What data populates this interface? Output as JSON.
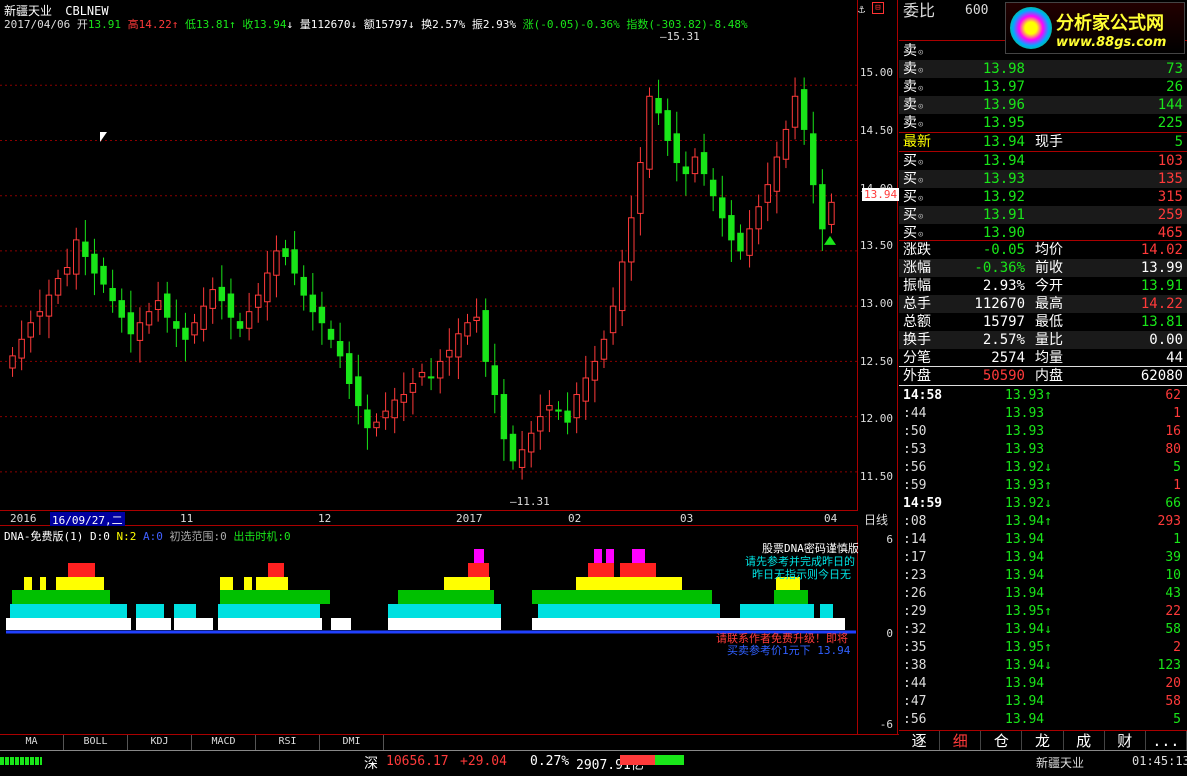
{
  "header": {
    "stock_name": "新疆天业",
    "formula": "CBLNEW",
    "date": "2017/04/06",
    "open_label": "开",
    "open_value": "13.91",
    "high_label": "高",
    "high_value": "14.22",
    "low_label": "低",
    "low_value": "13.81",
    "close_label": "收",
    "close_value": "13.94",
    "vol_label": "量",
    "vol_value": "112670",
    "amt_label": "额",
    "amt_value": "15797",
    "turn_label": "换",
    "turn_value": "2.57%",
    "amp_label": "振",
    "amp_value": "2.93%",
    "chg_text": "涨(-0.05)-0.36%",
    "index_text": "指数(-303.82)-8.48%"
  },
  "price_axis": {
    "ticks": [
      "15.00",
      "14.50",
      "14.00",
      "13.50",
      "13.00",
      "12.50",
      "12.00",
      "11.50"
    ],
    "current": "13.94"
  },
  "annotations": {
    "high_mark": "15.31",
    "low_mark": "11.31"
  },
  "x_axis": {
    "labels": [
      "2016",
      "16/09/27,二",
      "11",
      "12",
      "2017",
      "02",
      "03",
      "04"
    ],
    "right_label": "日线"
  },
  "indicator": {
    "name": "DNA-免费版(1)",
    "d_label": "D:0",
    "n_label": "N:2",
    "a_label": "A:0",
    "range_label": "初选范围:0",
    "timing_label": "出击时机:0",
    "axis_ticks": [
      "6",
      "0",
      "-6"
    ],
    "note1": "股票DNA密码谨慎版",
    "note2": "请先参考并完成昨日的",
    "note3": "昨日无指示则今日无",
    "note4": "请联系作者免费升级！即将",
    "note5": "买卖参考价1元下 13.94"
  },
  "bottom_tabs": [
    "MA",
    "BOLL",
    "KDJ",
    "MACD",
    "RSI",
    "DMI"
  ],
  "status_bar": {
    "market": "深",
    "index_value": "10656.17",
    "index_change": "+29.04",
    "index_pct": "0.27%",
    "turnover": "2907.91亿",
    "stock": "新疆天业",
    "time": "01:45:13"
  },
  "logo": {
    "title": "分析家公式网",
    "url": "www.88gs.com"
  },
  "quote": {
    "code": "600",
    "ratio_label": "委比",
    "sells": [
      {
        "label": "卖",
        "price": "",
        "vol": ""
      },
      {
        "label": "卖",
        "price": "13.98",
        "vol": "73"
      },
      {
        "label": "卖",
        "price": "13.97",
        "vol": "26"
      },
      {
        "label": "卖",
        "price": "13.96",
        "vol": "144"
      },
      {
        "label": "卖",
        "price": "13.95",
        "vol": "225"
      }
    ],
    "last_label": "最新",
    "last_price": "13.94",
    "cur_label": "现手",
    "cur_vol": "5",
    "buys": [
      {
        "label": "买",
        "price": "13.94",
        "vol": "103"
      },
      {
        "label": "买",
        "price": "13.93",
        "vol": "135"
      },
      {
        "label": "买",
        "price": "13.92",
        "vol": "315"
      },
      {
        "label": "买",
        "price": "13.91",
        "vol": "259"
      },
      {
        "label": "买",
        "price": "13.90",
        "vol": "465"
      }
    ],
    "stats": [
      {
        "l1": "涨跌",
        "v1": "-0.05",
        "c1": "down",
        "l2": "均价",
        "v2": "14.02",
        "c2": "up"
      },
      {
        "l1": "涨幅",
        "v1": "-0.36%",
        "c1": "down",
        "l2": "前收",
        "v2": "13.99",
        "c2": "white"
      },
      {
        "l1": "振幅",
        "v1": "2.93%",
        "c1": "white",
        "l2": "今开",
        "v2": "13.91",
        "c2": "down"
      },
      {
        "l1": "总手",
        "v1": "112670",
        "c1": "white",
        "l2": "最高",
        "v2": "14.22",
        "c2": "up"
      },
      {
        "l1": "总额",
        "v1": "15797",
        "c1": "white",
        "l2": "最低",
        "v2": "13.81",
        "c2": "down"
      },
      {
        "l1": "换手",
        "v1": "2.57%",
        "c1": "white",
        "l2": "量比",
        "v2": "0.00",
        "c2": "white"
      },
      {
        "l1": "分笔",
        "v1": "2574",
        "c1": "white",
        "l2": "均量",
        "v2": "44",
        "c2": "white"
      }
    ],
    "outer_label": "外盘",
    "outer_value": "50590",
    "inner_label": "内盘",
    "inner_value": "62080"
  },
  "ticks": [
    {
      "t": "14:58",
      "p": "13.93↑",
      "q": "62",
      "qc": "up",
      "bold": true
    },
    {
      "t": ":44",
      "p": "13.93",
      "q": "1",
      "qc": "up"
    },
    {
      "t": ":50",
      "p": "13.93",
      "q": "16",
      "qc": "up"
    },
    {
      "t": ":53",
      "p": "13.93",
      "q": "80",
      "qc": "up"
    },
    {
      "t": ":56",
      "p": "13.92↓",
      "q": "5",
      "qc": "down"
    },
    {
      "t": ":59",
      "p": "13.93↑",
      "q": "1",
      "qc": "up"
    },
    {
      "t": "14:59",
      "p": "13.92↓",
      "q": "66",
      "qc": "down",
      "bold": true
    },
    {
      "t": ":08",
      "p": "13.94↑",
      "q": "293",
      "qc": "up"
    },
    {
      "t": ":14",
      "p": "13.94",
      "q": "1",
      "qc": "down"
    },
    {
      "t": ":17",
      "p": "13.94",
      "q": "39",
      "qc": "down"
    },
    {
      "t": ":23",
      "p": "13.94",
      "q": "10",
      "qc": "down"
    },
    {
      "t": ":26",
      "p": "13.94",
      "q": "43",
      "qc": "down"
    },
    {
      "t": ":29",
      "p": "13.95↑",
      "q": "22",
      "qc": "up"
    },
    {
      "t": ":32",
      "p": "13.94↓",
      "q": "58",
      "qc": "down"
    },
    {
      "t": ":35",
      "p": "13.95↑",
      "q": "2",
      "qc": "up"
    },
    {
      "t": ":38",
      "p": "13.94↓",
      "q": "123",
      "qc": "down"
    },
    {
      "t": ":44",
      "p": "13.94",
      "q": "20",
      "qc": "up"
    },
    {
      "t": ":47",
      "p": "13.94",
      "q": "58",
      "qc": "up"
    },
    {
      "t": ":56",
      "p": "13.94",
      "q": "5",
      "qc": "down"
    }
  ],
  "right_tabs": [
    "逐",
    "细",
    "仓",
    "龙",
    "成",
    "财",
    "..."
  ],
  "colors": {
    "up": "#ff3a3a",
    "down": "#19e619",
    "grid": "#8b0000",
    "accent": "#ffff00"
  },
  "chart_data": {
    "type": "candlestick",
    "ylim": [
      11.2,
      15.5
    ],
    "high": 15.31,
    "low": 11.31,
    "closes": [
      12.55,
      12.7,
      12.85,
      12.95,
      13.1,
      13.25,
      13.35,
      13.6,
      13.45,
      13.3,
      13.2,
      13.05,
      12.9,
      12.75,
      12.85,
      12.95,
      13.05,
      12.9,
      12.8,
      12.7,
      12.85,
      13.0,
      13.15,
      13.05,
      12.9,
      12.8,
      12.95,
      13.1,
      13.3,
      13.5,
      13.45,
      13.3,
      13.1,
      12.95,
      12.85,
      12.7,
      12.55,
      12.3,
      12.1,
      11.9,
      11.95,
      12.05,
      12.15,
      12.2,
      12.3,
      12.4,
      12.35,
      12.5,
      12.6,
      12.75,
      12.85,
      12.9,
      12.5,
      12.2,
      11.8,
      11.6,
      11.7,
      11.85,
      12.0,
      12.1,
      12.05,
      11.95,
      12.2,
      12.35,
      12.5,
      12.7,
      13.0,
      13.4,
      13.8,
      14.3,
      14.9,
      14.75,
      14.5,
      14.3,
      14.2,
      14.35,
      14.2,
      14.0,
      13.8,
      13.6,
      13.5,
      13.7,
      13.9,
      14.1,
      14.35,
      14.6,
      14.9,
      14.6,
      14.1,
      13.7,
      13.94
    ]
  }
}
